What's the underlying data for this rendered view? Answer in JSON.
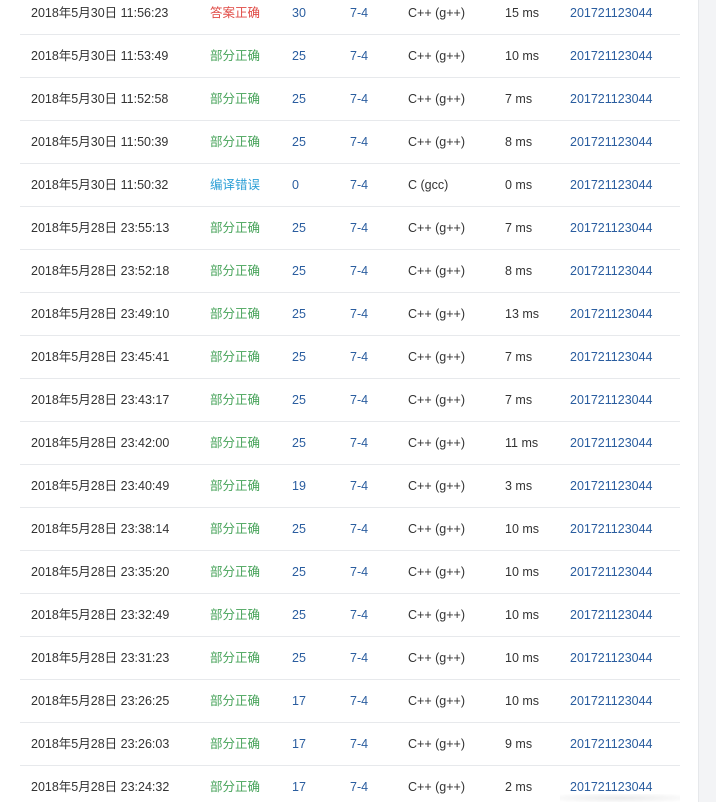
{
  "colors": {
    "accepted": "#e04b46",
    "partial": "#47a35a",
    "compile_error": "#2b9fd6",
    "link": "#2a5d9f",
    "text": "#333333"
  },
  "rows": [
    {
      "time": "2018年5月30日 11:56:23",
      "status": "答案正确",
      "status_kind": "accepted",
      "score": "30",
      "problem": "7-4",
      "lang": "C++ (g++)",
      "elapsed": "15 ms",
      "user": "201721123044"
    },
    {
      "time": "2018年5月30日 11:53:49",
      "status": "部分正确",
      "status_kind": "partial",
      "score": "25",
      "problem": "7-4",
      "lang": "C++ (g++)",
      "elapsed": "10 ms",
      "user": "201721123044"
    },
    {
      "time": "2018年5月30日 11:52:58",
      "status": "部分正确",
      "status_kind": "partial",
      "score": "25",
      "problem": "7-4",
      "lang": "C++ (g++)",
      "elapsed": "7 ms",
      "user": "201721123044"
    },
    {
      "time": "2018年5月30日 11:50:39",
      "status": "部分正确",
      "status_kind": "partial",
      "score": "25",
      "problem": "7-4",
      "lang": "C++ (g++)",
      "elapsed": "8 ms",
      "user": "201721123044"
    },
    {
      "time": "2018年5月30日 11:50:32",
      "status": "编译错误",
      "status_kind": "compile",
      "score": "0",
      "problem": "7-4",
      "lang": "C (gcc)",
      "elapsed": "0 ms",
      "user": "201721123044"
    },
    {
      "time": "2018年5月28日 23:55:13",
      "status": "部分正确",
      "status_kind": "partial",
      "score": "25",
      "problem": "7-4",
      "lang": "C++ (g++)",
      "elapsed": "7 ms",
      "user": "201721123044"
    },
    {
      "time": "2018年5月28日 23:52:18",
      "status": "部分正确",
      "status_kind": "partial",
      "score": "25",
      "problem": "7-4",
      "lang": "C++ (g++)",
      "elapsed": "8 ms",
      "user": "201721123044"
    },
    {
      "time": "2018年5月28日 23:49:10",
      "status": "部分正确",
      "status_kind": "partial",
      "score": "25",
      "problem": "7-4",
      "lang": "C++ (g++)",
      "elapsed": "13 ms",
      "user": "201721123044"
    },
    {
      "time": "2018年5月28日 23:45:41",
      "status": "部分正确",
      "status_kind": "partial",
      "score": "25",
      "problem": "7-4",
      "lang": "C++ (g++)",
      "elapsed": "7 ms",
      "user": "201721123044"
    },
    {
      "time": "2018年5月28日 23:43:17",
      "status": "部分正确",
      "status_kind": "partial",
      "score": "25",
      "problem": "7-4",
      "lang": "C++ (g++)",
      "elapsed": "7 ms",
      "user": "201721123044"
    },
    {
      "time": "2018年5月28日 23:42:00",
      "status": "部分正确",
      "status_kind": "partial",
      "score": "25",
      "problem": "7-4",
      "lang": "C++ (g++)",
      "elapsed": "11 ms",
      "user": "201721123044"
    },
    {
      "time": "2018年5月28日 23:40:49",
      "status": "部分正确",
      "status_kind": "partial",
      "score": "19",
      "problem": "7-4",
      "lang": "C++ (g++)",
      "elapsed": "3 ms",
      "user": "201721123044"
    },
    {
      "time": "2018年5月28日 23:38:14",
      "status": "部分正确",
      "status_kind": "partial",
      "score": "25",
      "problem": "7-4",
      "lang": "C++ (g++)",
      "elapsed": "10 ms",
      "user": "201721123044"
    },
    {
      "time": "2018年5月28日 23:35:20",
      "status": "部分正确",
      "status_kind": "partial",
      "score": "25",
      "problem": "7-4",
      "lang": "C++ (g++)",
      "elapsed": "10 ms",
      "user": "201721123044"
    },
    {
      "time": "2018年5月28日 23:32:49",
      "status": "部分正确",
      "status_kind": "partial",
      "score": "25",
      "problem": "7-4",
      "lang": "C++ (g++)",
      "elapsed": "10 ms",
      "user": "201721123044"
    },
    {
      "time": "2018年5月28日 23:31:23",
      "status": "部分正确",
      "status_kind": "partial",
      "score": "25",
      "problem": "7-4",
      "lang": "C++ (g++)",
      "elapsed": "10 ms",
      "user": "201721123044"
    },
    {
      "time": "2018年5月28日 23:26:25",
      "status": "部分正确",
      "status_kind": "partial",
      "score": "17",
      "problem": "7-4",
      "lang": "C++ (g++)",
      "elapsed": "10 ms",
      "user": "201721123044"
    },
    {
      "time": "2018年5月28日 23:26:03",
      "status": "部分正确",
      "status_kind": "partial",
      "score": "17",
      "problem": "7-4",
      "lang": "C++ (g++)",
      "elapsed": "9 ms",
      "user": "201721123044"
    },
    {
      "time": "2018年5月28日 23:24:32",
      "status": "部分正确",
      "status_kind": "partial",
      "score": "17",
      "problem": "7-4",
      "lang": "C++ (g++)",
      "elapsed": "2 ms",
      "user": "201721123044"
    }
  ]
}
